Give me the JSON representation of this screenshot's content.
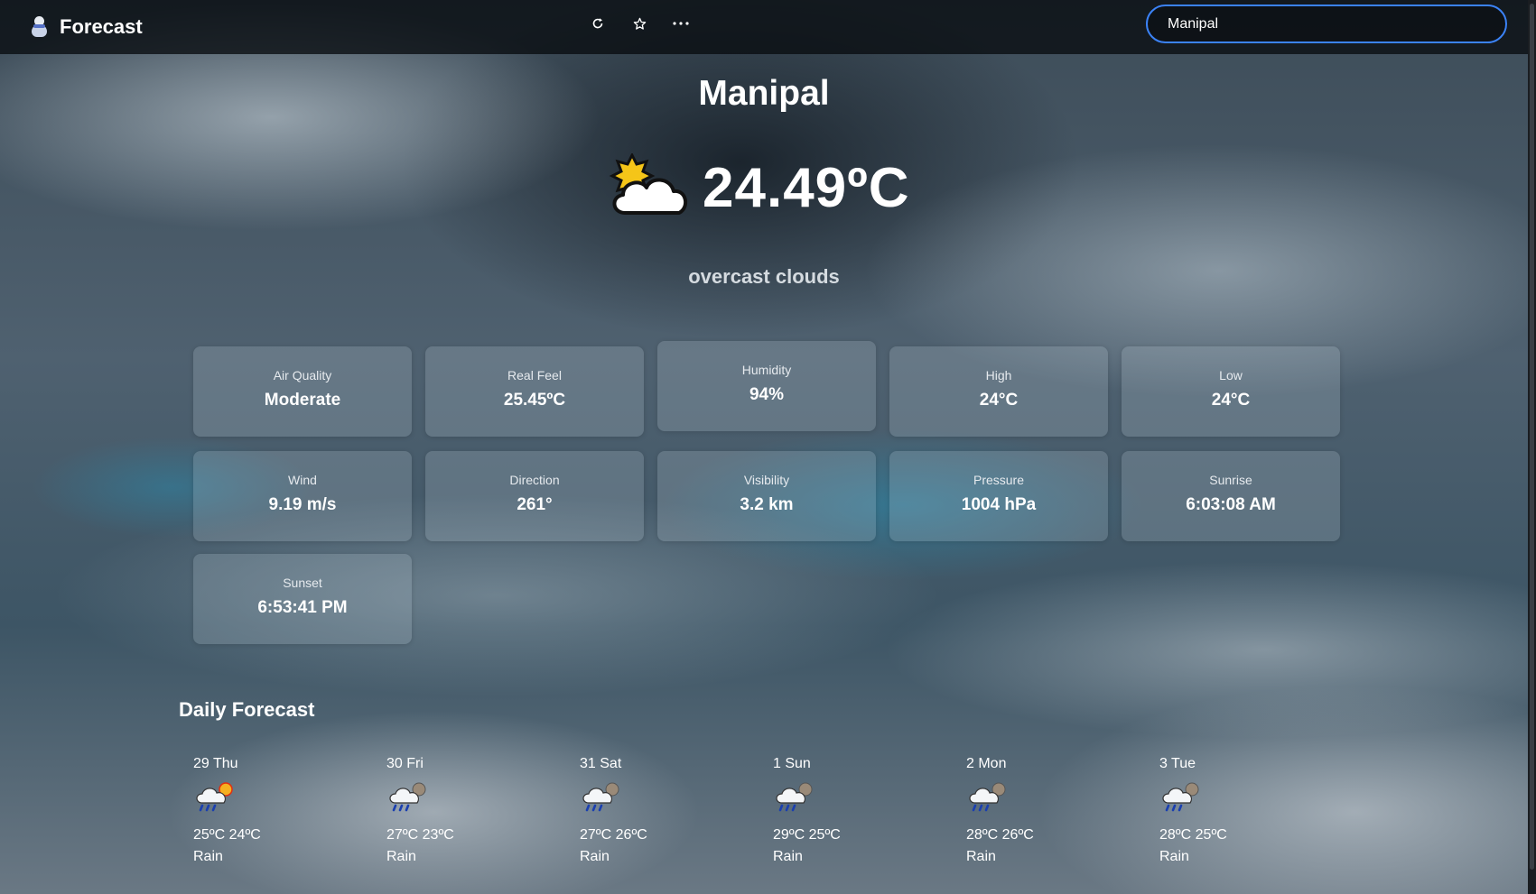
{
  "header": {
    "app_title": "Forecast",
    "search_value": "Manipal"
  },
  "current": {
    "city": "Manipal",
    "temperature": "24.49ºC",
    "description": "overcast clouds"
  },
  "stats": [
    {
      "label": "Air Quality",
      "value": "Moderate"
    },
    {
      "label": "Real Feel",
      "value": "25.45ºC"
    },
    {
      "label": "Humidity",
      "value": "94%"
    },
    {
      "label": "High",
      "value": "24°C"
    },
    {
      "label": "Low",
      "value": "24°C"
    },
    {
      "label": "Wind",
      "value": "9.19 m/s"
    },
    {
      "label": "Direction",
      "value": "261°"
    },
    {
      "label": "Visibility",
      "value": "3.2 km"
    },
    {
      "label": "Pressure",
      "value": "1004 hPa"
    },
    {
      "label": "Sunrise",
      "value": "6:03:08 AM"
    },
    {
      "label": "Sunset",
      "value": "6:53:41 PM"
    }
  ],
  "daily": {
    "title": "Daily Forecast",
    "days": [
      {
        "day": "29 Thu",
        "temps": "25ºC 24ºC",
        "desc": "Rain",
        "icon": "rain-sun-icon"
      },
      {
        "day": "30 Fri",
        "temps": "27ºC 23ºC",
        "desc": "Rain",
        "icon": "rain-moon-icon"
      },
      {
        "day": "31 Sat",
        "temps": "27ºC 26ºC",
        "desc": "Rain",
        "icon": "rain-moon-icon"
      },
      {
        "day": "1 Sun",
        "temps": "29ºC 25ºC",
        "desc": "Rain",
        "icon": "rain-moon-icon"
      },
      {
        "day": "2 Mon",
        "temps": "28ºC 26ºC",
        "desc": "Rain",
        "icon": "rain-moon-icon"
      },
      {
        "day": "3 Tue",
        "temps": "28ºC 25ºC",
        "desc": "Rain",
        "icon": "rain-moon-icon"
      }
    ]
  }
}
